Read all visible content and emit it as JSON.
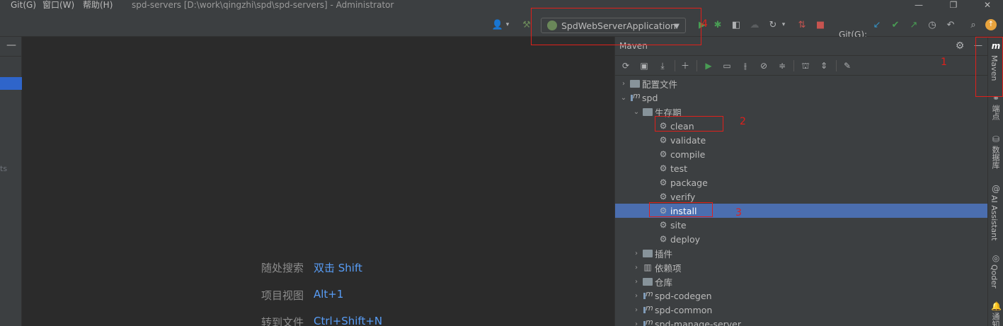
{
  "menu": {
    "items": [
      "Git(G)",
      "窗口(W)",
      "帮助(H)"
    ],
    "window_title": "spd-servers [D:\\work\\qingzhi\\spd\\spd-servers] - Administrator"
  },
  "toolbar": {
    "run_config": "SpdWebServerApplication",
    "git_label": "Git(G):"
  },
  "left_panel": {
    "partial_text": "ts"
  },
  "editor": {
    "hints": [
      {
        "label": "随处搜索",
        "key": "双击 Shift"
      },
      {
        "label": "项目视图",
        "key": "Alt+1"
      },
      {
        "label": "转到文件",
        "key": "Ctrl+Shift+N"
      }
    ]
  },
  "maven": {
    "title": "Maven",
    "tree": [
      {
        "label": "配置文件",
        "level": 0,
        "expanded": false,
        "icon": "profiles-folder-icon"
      },
      {
        "label": "spd",
        "level": 0,
        "expanded": true,
        "icon": "maven-module-icon"
      },
      {
        "label": "生存期",
        "level": 1,
        "expanded": true,
        "icon": "lifecycle-folder-icon"
      },
      {
        "label": "clean",
        "level": 2,
        "icon": "gear-icon"
      },
      {
        "label": "validate",
        "level": 2,
        "icon": "gear-icon"
      },
      {
        "label": "compile",
        "level": 2,
        "icon": "gear-icon"
      },
      {
        "label": "test",
        "level": 2,
        "icon": "gear-icon"
      },
      {
        "label": "package",
        "level": 2,
        "icon": "gear-icon"
      },
      {
        "label": "verify",
        "level": 2,
        "icon": "gear-icon"
      },
      {
        "label": "install",
        "level": 2,
        "icon": "gear-icon",
        "selected": true
      },
      {
        "label": "site",
        "level": 2,
        "icon": "gear-icon"
      },
      {
        "label": "deploy",
        "level": 2,
        "icon": "gear-icon"
      },
      {
        "label": "插件",
        "level": 1,
        "expanded": false,
        "icon": "plugins-folder-icon"
      },
      {
        "label": "依赖项",
        "level": 1,
        "expanded": false,
        "icon": "dependencies-icon"
      },
      {
        "label": "仓库",
        "level": 1,
        "expanded": false,
        "icon": "repositories-folder-icon"
      },
      {
        "label": "spd-codegen",
        "level": 0,
        "expanded": false,
        "icon": "maven-module-icon"
      },
      {
        "label": "spd-common",
        "level": 0,
        "expanded": false,
        "icon": "maven-module-icon"
      },
      {
        "label": "spd-manage-server",
        "level": 0,
        "expanded": false,
        "icon": "maven-module-icon"
      }
    ]
  },
  "right_strip": {
    "tabs": [
      "Maven",
      "端点",
      "数据库",
      "AI Assistant",
      "Qoder",
      "通知"
    ]
  },
  "annotations": [
    "1",
    "2",
    "3",
    "4"
  ],
  "colors": {
    "accent": "#4b6eaf",
    "annotation": "#e0201b",
    "link": "#589df6",
    "run": "#499c54"
  }
}
